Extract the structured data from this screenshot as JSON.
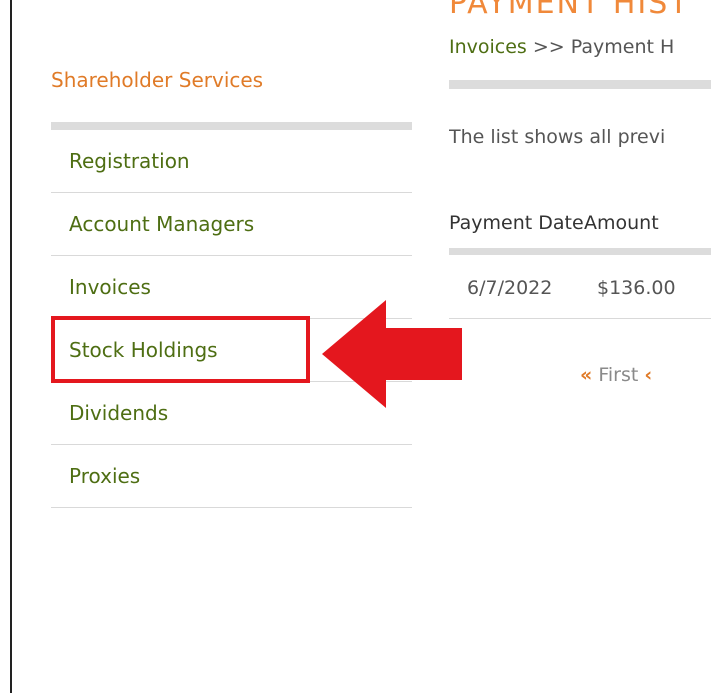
{
  "sidebar": {
    "title": "Shareholder Services",
    "items": [
      {
        "label": "Registration"
      },
      {
        "label": "Account Managers"
      },
      {
        "label": "Invoices"
      },
      {
        "label": "Stock Holdings"
      },
      {
        "label": "Dividends"
      },
      {
        "label": "Proxies"
      }
    ],
    "highlighted_item": "Stock Holdings"
  },
  "main": {
    "heading": "PAYMENT HIST",
    "breadcrumb": {
      "link": "Invoices",
      "separator": " >> ",
      "current": "Payment H"
    },
    "description": "The list shows all previ",
    "table": {
      "headers": [
        "Payment Date",
        "Amount"
      ],
      "rows": [
        [
          "6/7/2022",
          "$136.00"
        ]
      ]
    },
    "pagination": {
      "first_label": "First",
      "first_icon": "double-chevron-left-icon",
      "prev_icon": "chevron-left-icon"
    }
  },
  "colors": {
    "accent_orange": "#e07b28",
    "link_green": "#4e6e13",
    "highlight_red": "#e4171e"
  }
}
